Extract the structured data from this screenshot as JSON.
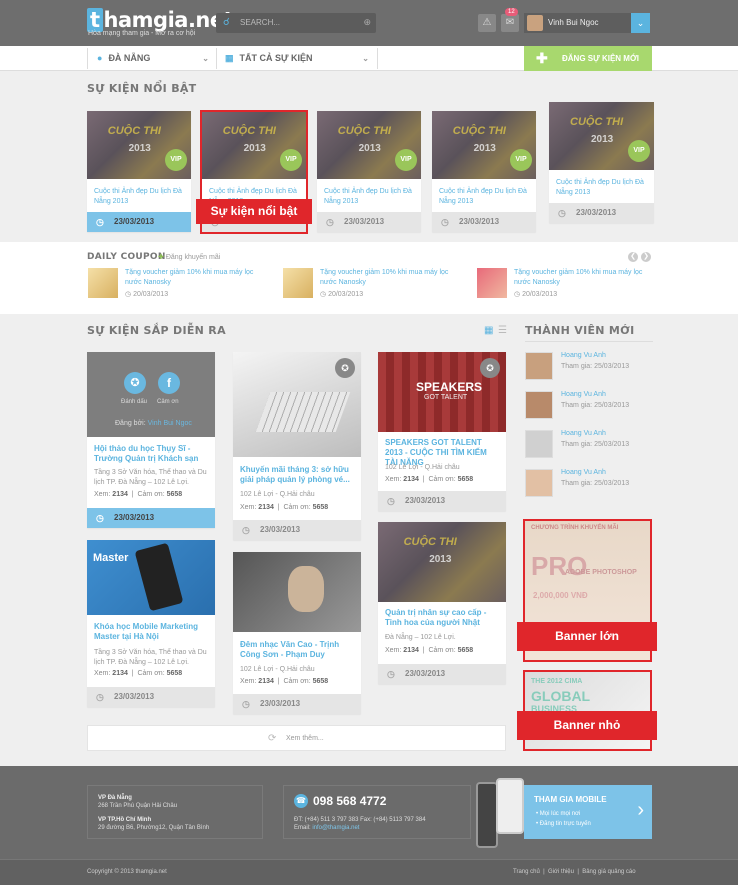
{
  "header": {
    "logo_t": "t",
    "logo_rest": "hamgia.net",
    "tagline": "Hòa mạng tham gia - Mở ra cơ hội",
    "search_placeholder": "SEARCH...",
    "notification_count": "12",
    "user_name": "Vinh Bui Ngoc"
  },
  "nav": {
    "city": "ĐÀ NẴNG",
    "category": "TẤT CẢ SỰ KIỆN",
    "create_label": "ĐĂNG SỰ KIỆN MỚI"
  },
  "featured": {
    "title": "SỰ KIỆN NỔI BẬT",
    "annotation": "Sự kiện nổi bật",
    "items": [
      {
        "title": "Cuộc thi Ảnh đẹp Du lịch Đà Nẵng 2013",
        "date": "23/03/2013",
        "badge": "VIP",
        "img_title": "CUỘC THI",
        "img_year": "2013"
      },
      {
        "title": "Cuộc thi Ảnh đẹp Du lịch Đà Nẵng 2013",
        "date": "23/03/2013",
        "badge": "VIP",
        "img_title": "CUỘC THI",
        "img_year": "2013"
      },
      {
        "title": "Cuộc thi Ảnh đẹp Du lịch Đà Nẵng 2013",
        "date": "23/03/2013",
        "badge": "VIP",
        "img_title": "CUỘC THI",
        "img_year": "2013"
      },
      {
        "title": "Cuộc thi Ảnh đẹp Du lịch Đà Nẵng 2013",
        "date": "23/03/2013",
        "badge": "VIP",
        "img_title": "CUỘC THI",
        "img_year": "2013"
      },
      {
        "title": "Cuộc thi Ảnh đẹp Du lịch Đà Nẵng 2013",
        "date": "23/03/2013",
        "badge": "VIP",
        "img_title": "CUỘC THI",
        "img_year": "2013"
      }
    ]
  },
  "coupon": {
    "title": "DAILY COUPON",
    "add_label": "Đăng khuyến mãi",
    "items": [
      {
        "title": "Tặng voucher giảm 10% khi mua máy lọc nước Nanosky",
        "date": "20/03/2013"
      },
      {
        "title": "Tặng voucher giảm 10% khi mua máy lọc nước Nanosky",
        "date": "20/03/2013"
      },
      {
        "title": "Tặng voucher giảm 10% khi mua máy lọc nước Nanosky",
        "date": "20/03/2013"
      }
    ]
  },
  "upcoming": {
    "title": "SỰ KIỆN SẮP DIỄN RA",
    "hover": {
      "follow": "Đánh dấu",
      "interest": "Cảm ơn",
      "posted_by_label": "Đăng bởi:",
      "posted_by": "Vinh Bui Ngoc"
    },
    "col1": [
      {
        "title": "Hội thảo du học Thụy Sĩ - Trường Quản trị Khách sạn",
        "address": "Tầng 3 Sở Văn hóa, Thể thao và Du lịch TP. Đà Nẵng – 102 Lê Lợi.",
        "views": "2134",
        "thanks": "5658",
        "date": "23/03/2013"
      },
      {
        "title": "Khóa học Mobile Marketing Master tại Hà Nội",
        "address": "Tầng 3 Sở Văn hóa, Thể thao và Du lịch TP. Đà Nẵng – 102 Lê Lợi.",
        "views": "2134",
        "thanks": "5658",
        "date": "23/03/2013",
        "img_label": "Master"
      }
    ],
    "col2": [
      {
        "title": "Khuyến mãi tháng 3: sở hữu giải pháp quản lý phòng vé...",
        "address": "102 Lê Lợi - Q.Hải châu",
        "views": "2134",
        "thanks": "5658",
        "date": "23/03/2013"
      },
      {
        "title": "Đêm nhạc Văn Cao - Trịnh Công Sơn - Phạm Duy",
        "address": "102 Lê Lợi - Q.Hải châu",
        "views": "2134",
        "thanks": "5658",
        "date": "23/03/2013"
      }
    ],
    "col3": [
      {
        "title": "SPEAKERS GOT TALENT 2013 - CUỘC THI TÌM KIẾM TÀI NĂNG",
        "address": "102 Lê Lợi - Q.Hải châu",
        "views": "2134",
        "thanks": "5658",
        "date": "23/03/2013",
        "img_label": "SPEAKERS",
        "img_sub": "GOT TALENT"
      },
      {
        "title": "Quản trị nhân sự cao cấp - Tinh hoa của người Nhật",
        "address": "Đà Nẵng – 102 Lê Lợi.",
        "views": "2134",
        "thanks": "5658",
        "date": "23/03/2013",
        "img_title": "CUỘC THI",
        "img_year": "2013"
      }
    ],
    "views_label": "Xem:",
    "thanks_label": "Cảm ơn:",
    "load_more": "Xem thêm..."
  },
  "members": {
    "title": "THÀNH VIÊN MỚI",
    "items": [
      {
        "name": "Hoang Vu Anh",
        "joined": "Tham gia: 25/03/2013"
      },
      {
        "name": "Hoang Vu Anh",
        "joined": "Tham gia: 25/03/2013"
      },
      {
        "name": "Hoang Vu Anh",
        "joined": "Tham gia: 25/03/2013"
      },
      {
        "name": "Hoang Vu Anh",
        "joined": "Tham gia: 25/03/2013"
      }
    ]
  },
  "banners": {
    "large_label": "Banner lớn",
    "small_label": "Banner nhỏ",
    "large_text1": "CHƯƠNG TRÌNH KHUYẾN MÃI",
    "large_text2": "PRO",
    "large_text3": "ADOBE PHOTOSHOP",
    "large_text4": "2,000,000 VNĐ",
    "small_text1": "THE 2012 CIMA",
    "small_text2": "GLOBAL",
    "small_text3": "BUSINESS"
  },
  "footer": {
    "office1_title": "VP Đà Nẵng",
    "office1_addr": "268 Trần Phú Quận Hải Châu",
    "office2_title": "VP TP.Hồ Chí Minh",
    "office2_addr": "29 đường B6, Phường12, Quận Tân Bình",
    "phone": "098 568 4772",
    "contact_line": "ĐT: (+84) 511 3 797 383 Fax: (+84) 5113 797 384",
    "email_label": "Email:",
    "email": "info@thamgia.net",
    "mobile_title": "THAM GIA MOBILE",
    "mobile_item1": "Mọi lúc mọi nơi",
    "mobile_item2": "Đăng tin trực tuyến",
    "copyright": "Copyright © 2013 thamgia.net",
    "links": [
      "Trang chủ",
      "Giới thiệu",
      "Bảng giá quảng cáo"
    ]
  }
}
